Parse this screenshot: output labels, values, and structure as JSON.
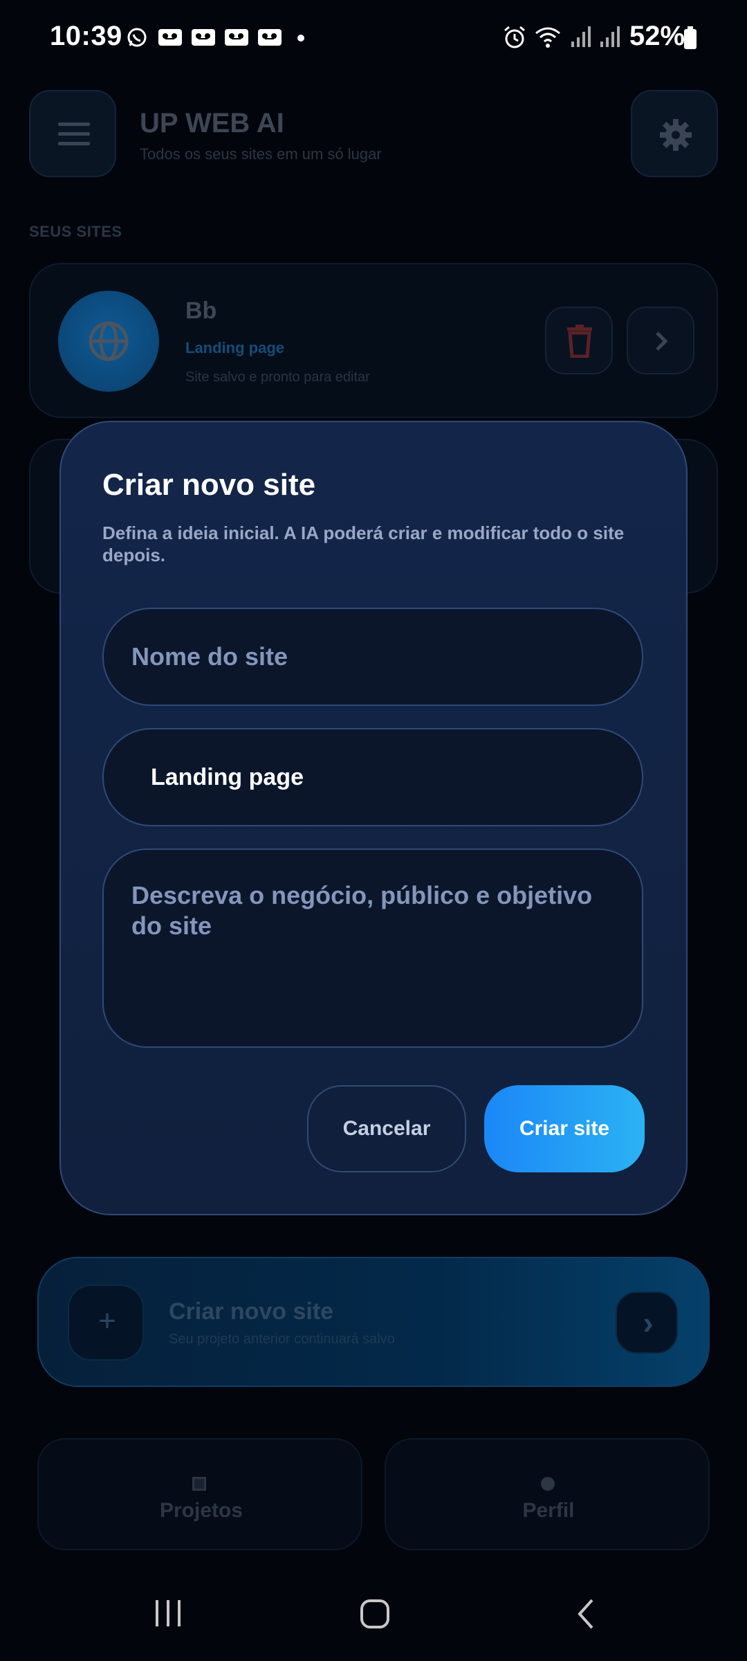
{
  "status_bar": {
    "time": "10:39",
    "battery": "52%",
    "notifications": [
      "whatsapp-icon",
      "voicemail-icon",
      "voicemail-icon",
      "voicemail-icon",
      "voicemail-icon"
    ],
    "status_icons": [
      "alarm-icon",
      "wifi-icon",
      "signal-icon",
      "signal-icon",
      "battery-icon"
    ]
  },
  "header": {
    "title": "UP WEB AI",
    "subtitle": "Todos os seus sites em um só lugar",
    "menu_icon": "menu-icon",
    "settings_icon": "gear-icon"
  },
  "sites_section": {
    "label": "SEUS SITES",
    "sites": [
      {
        "name": "Bb",
        "type": "Landing page",
        "status": "Site salvo e pronto para editar",
        "icon": "globe-icon"
      }
    ]
  },
  "create_banner": {
    "title": "Criar novo site",
    "subtitle": "Seu projeto anterior continuará salvo",
    "plus": "+",
    "arrow": "›"
  },
  "bottom_nav": {
    "tabs": [
      {
        "label": "Projetos",
        "icon": "square-icon"
      },
      {
        "label": "Perfil",
        "icon": "circle-icon"
      }
    ]
  },
  "modal": {
    "title": "Criar novo site",
    "description": "Defina a ideia inicial. A IA poderá criar e modificar todo o site depois.",
    "name_placeholder": "Nome do site",
    "name_value": "",
    "type_selected": "Landing page",
    "description_placeholder": "Descreva o negócio, público e objetivo do site",
    "description_value": "",
    "cancel_label": "Cancelar",
    "create_label": "Criar site"
  },
  "colors": {
    "accent_start": "#1a87f6",
    "accent_end": "#2bb2f4",
    "modal_bg": "#13264a",
    "app_bg": "#02050c"
  }
}
